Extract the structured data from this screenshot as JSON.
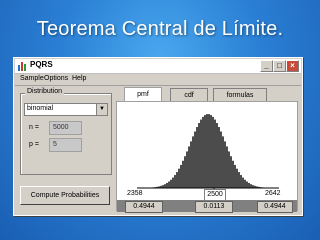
{
  "slide": {
    "title": "Teorema Central de Límite."
  },
  "window": {
    "title": "PQRS",
    "buttons": {
      "minimize": "_",
      "maximize": "□",
      "close": "×"
    }
  },
  "menu": {
    "items": [
      "Sample",
      "Options",
      "Help"
    ]
  },
  "distribution": {
    "group_label": "Distribution",
    "selected": "binomial",
    "params": [
      {
        "label": "n =",
        "value": "5000"
      },
      {
        "label": "p =",
        "value": "5"
      }
    ]
  },
  "compute_button": "Compute Probabilities",
  "tabs": [
    "pmf",
    "cdf",
    "formulas"
  ],
  "active_tab": "pmf",
  "axis": {
    "left": "2358",
    "center": "2500",
    "right": "2642"
  },
  "probabilities": {
    "left": "0.4944",
    "center": "0.0113",
    "right": "0.4944"
  },
  "colors": {
    "bars": "#000000",
    "slide_bg": "#2a7fd4",
    "window_bg": "#d4d0c8"
  },
  "chart_data": {
    "type": "bar",
    "x_range": [
      2358,
      2642
    ],
    "mean": 2500,
    "sd": 35.36,
    "bin_step": 4
  }
}
